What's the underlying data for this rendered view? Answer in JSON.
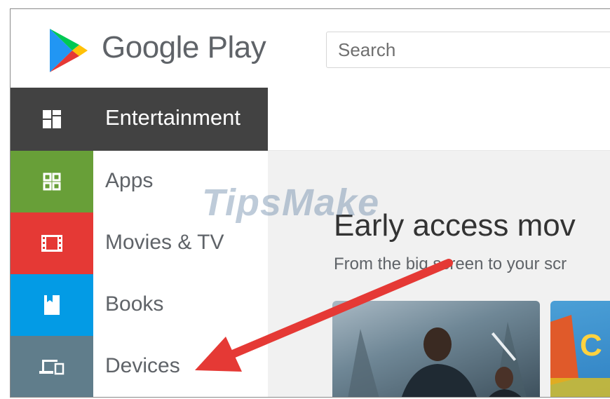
{
  "header": {
    "logo_text": "Google Play",
    "search_placeholder": "Search"
  },
  "nav": {
    "label": "Entertainment",
    "color": "#424242"
  },
  "sidebar": {
    "items": [
      {
        "label": "Apps",
        "color": "#689f38",
        "icon": "apps-icon"
      },
      {
        "label": "Movies & TV",
        "color": "#e53935",
        "icon": "film-icon"
      },
      {
        "label": "Books",
        "color": "#039be5",
        "icon": "book-icon"
      },
      {
        "label": "Devices",
        "color": "#607d8b",
        "icon": "devices-icon"
      }
    ]
  },
  "content": {
    "title": "Early access mov",
    "subtitle": "From the big screen to your scr",
    "card2_text": "C"
  },
  "watermark": "TipsMake",
  "annotation": {
    "arrow_color": "#e53935"
  }
}
